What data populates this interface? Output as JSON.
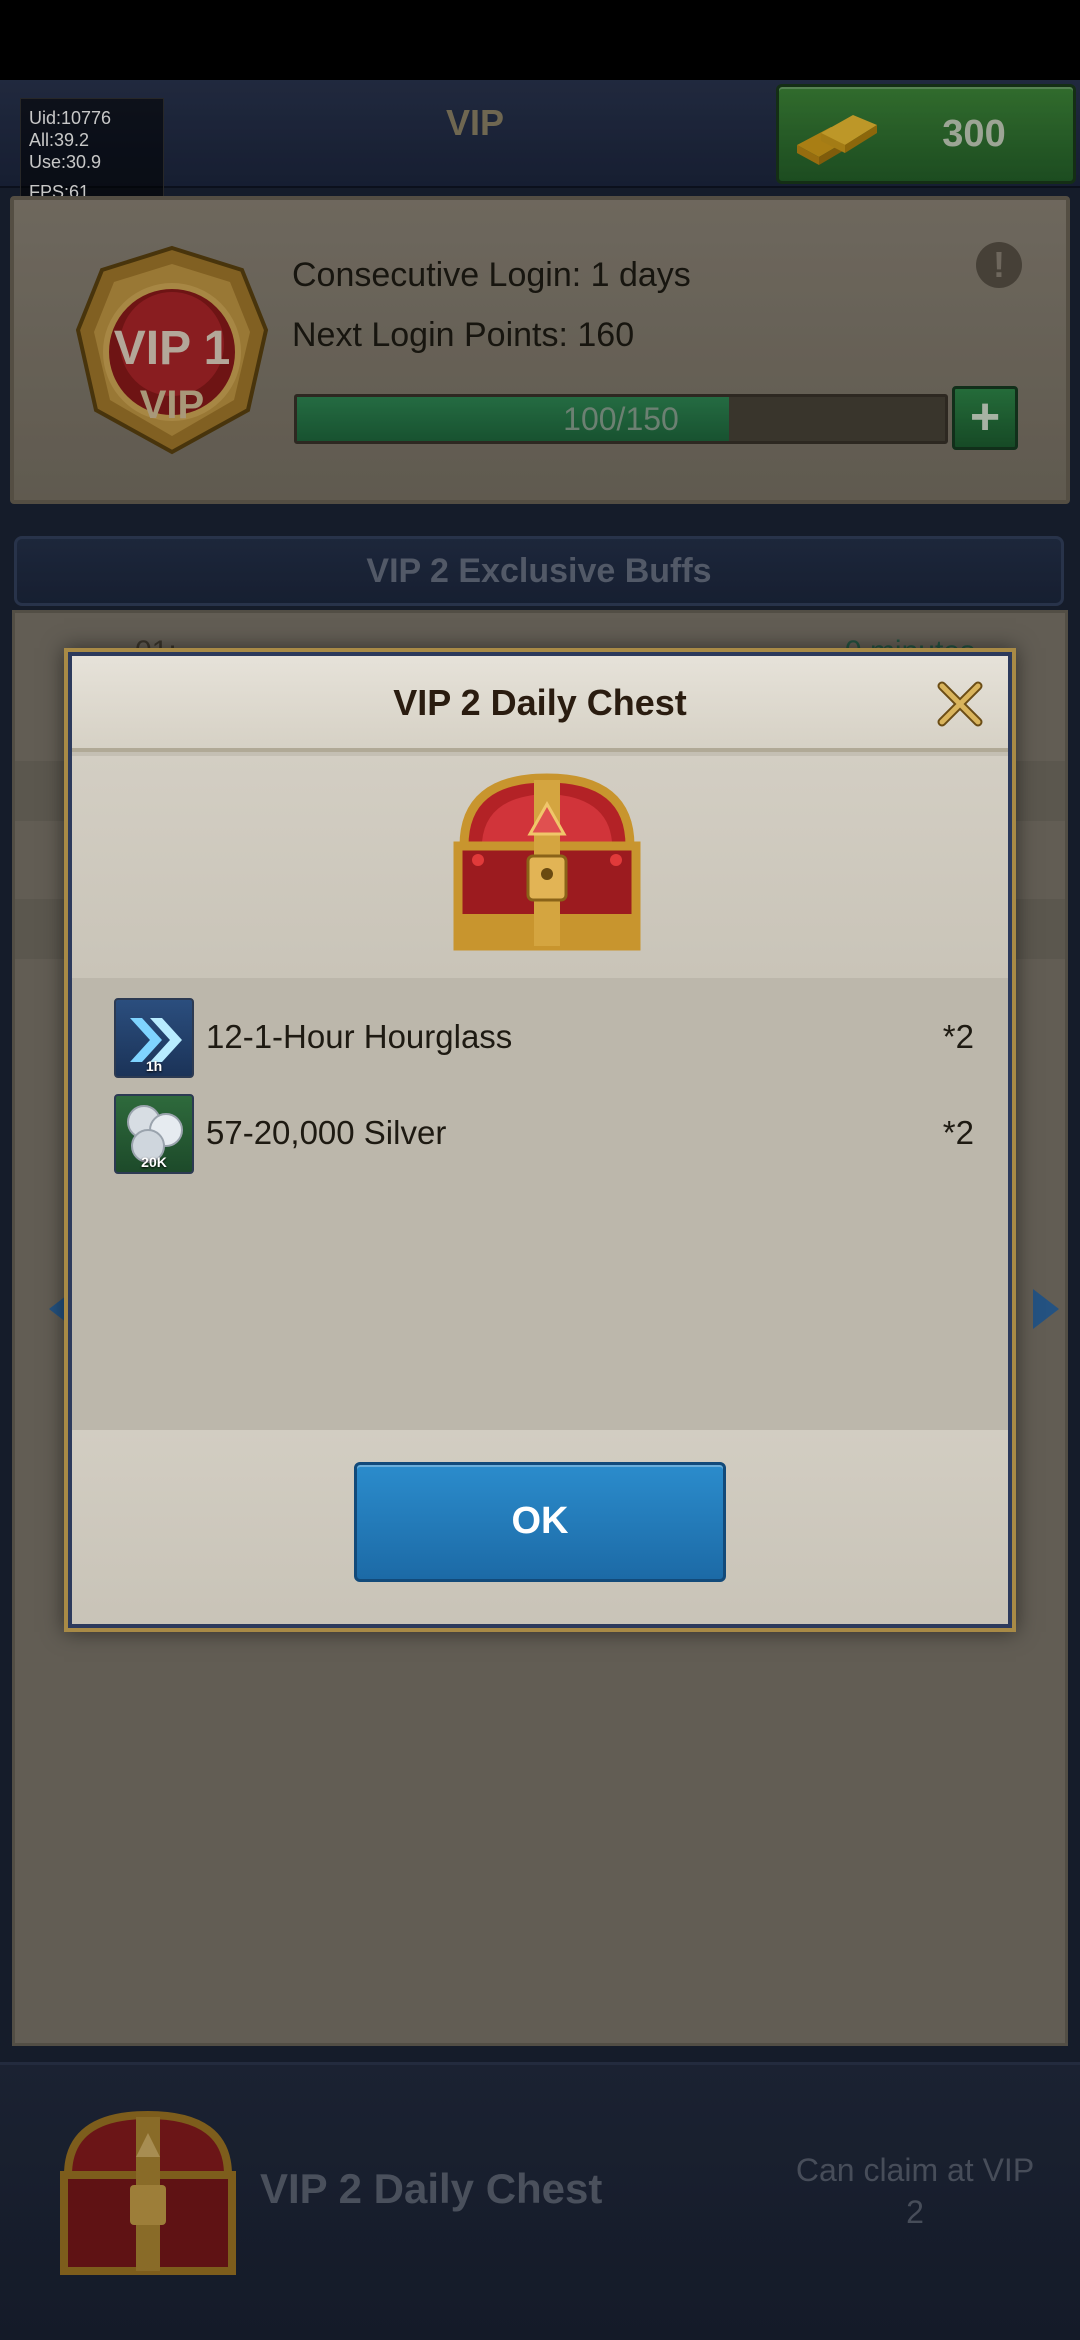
{
  "debug": {
    "uid": "Uid:10776",
    "all": "All:39.2",
    "use": "Use:30.9",
    "fps": "FPS:61"
  },
  "header": {
    "title": "VIP",
    "gold_value": "300"
  },
  "vip_card": {
    "badge_level": "VIP 1",
    "badge_sub": "VIP",
    "consecutive_login": "Consecutive Login: 1 days",
    "next_login_points": "Next Login Points: 160",
    "progress_label": "100/150",
    "progress_fraction": 0.667,
    "plus_label": "+",
    "info_label": "!"
  },
  "buffs": {
    "title": "VIP 2 Exclusive Buffs"
  },
  "list_partial": {
    "left": "01:",
    "right": "0 minutes"
  },
  "footer": {
    "title": "VIP 2 Daily Chest",
    "status": "Can claim at VIP 2"
  },
  "modal": {
    "title": "VIP 2 Daily Chest",
    "ok_label": "OK",
    "items": [
      {
        "name": "12-1-Hour Hourglass",
        "qty": "*2",
        "icon": "hourglass-speedup-icon",
        "tag": "1h"
      },
      {
        "name": "57-20,000 Silver",
        "qty": "*2",
        "icon": "silver-coins-icon",
        "tag": "20K"
      }
    ]
  },
  "colors": {
    "accent_green": "#2f8a55",
    "ok_blue": "#2b8ccc",
    "frame_gold": "#a88a46"
  }
}
